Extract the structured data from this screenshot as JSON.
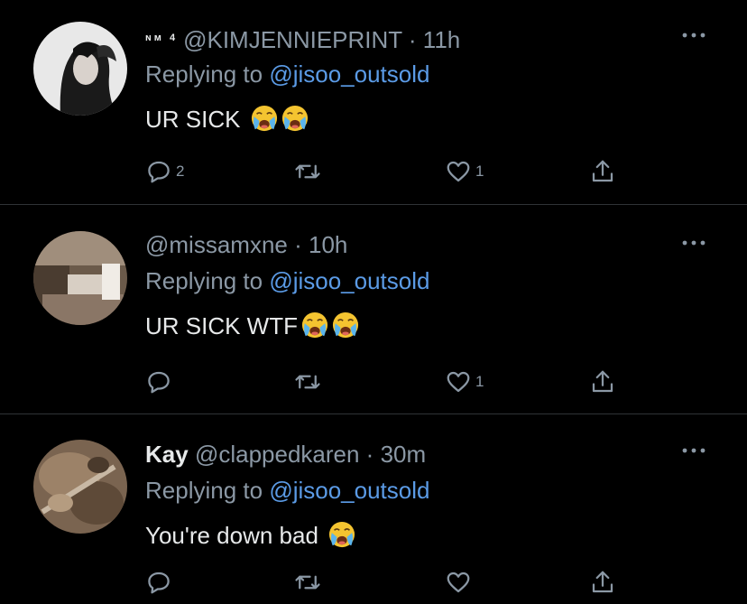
{
  "tweets": [
    {
      "display_name": "ɴᴍ 4",
      "handle": "@KIMJENNIEPRINT",
      "separator": " · ",
      "time": "11h",
      "replying_prefix": "Replying to ",
      "replying_to": "@jisoo_outsold",
      "text": "UR SICK",
      "emoji_count": 2,
      "reply_count": "2",
      "retweet_count": "",
      "like_count": "1"
    },
    {
      "display_name": "",
      "handle": "@missamxne",
      "separator": " · ",
      "time": "10h",
      "replying_prefix": "Replying to ",
      "replying_to": "@jisoo_outsold",
      "text": "UR SICK WTF",
      "emoji_count": 2,
      "reply_count": "",
      "retweet_count": "",
      "like_count": "1"
    },
    {
      "display_name": "Kay",
      "handle": "@clappedkaren",
      "separator": " · ",
      "time": "30m",
      "replying_prefix": "Replying to ",
      "replying_to": "@jisoo_outsold",
      "text": "You're down bad",
      "emoji_count": 1,
      "reply_count": "",
      "retweet_count": "",
      "like_count": ""
    }
  ],
  "icons": {
    "reply": "reply-icon",
    "retweet": "retweet-icon",
    "like": "heart-icon",
    "share": "share-icon",
    "more": "more-icon",
    "emoji": "loudly-crying-face-emoji"
  },
  "colors": {
    "background": "#000000",
    "primary_text": "#e7e9ea",
    "secondary_text": "#8b98a5",
    "link": "#5b9be6",
    "divider": "#2f3336",
    "emoji_face": "#f4c430",
    "emoji_tears": "#5ab4ec"
  }
}
